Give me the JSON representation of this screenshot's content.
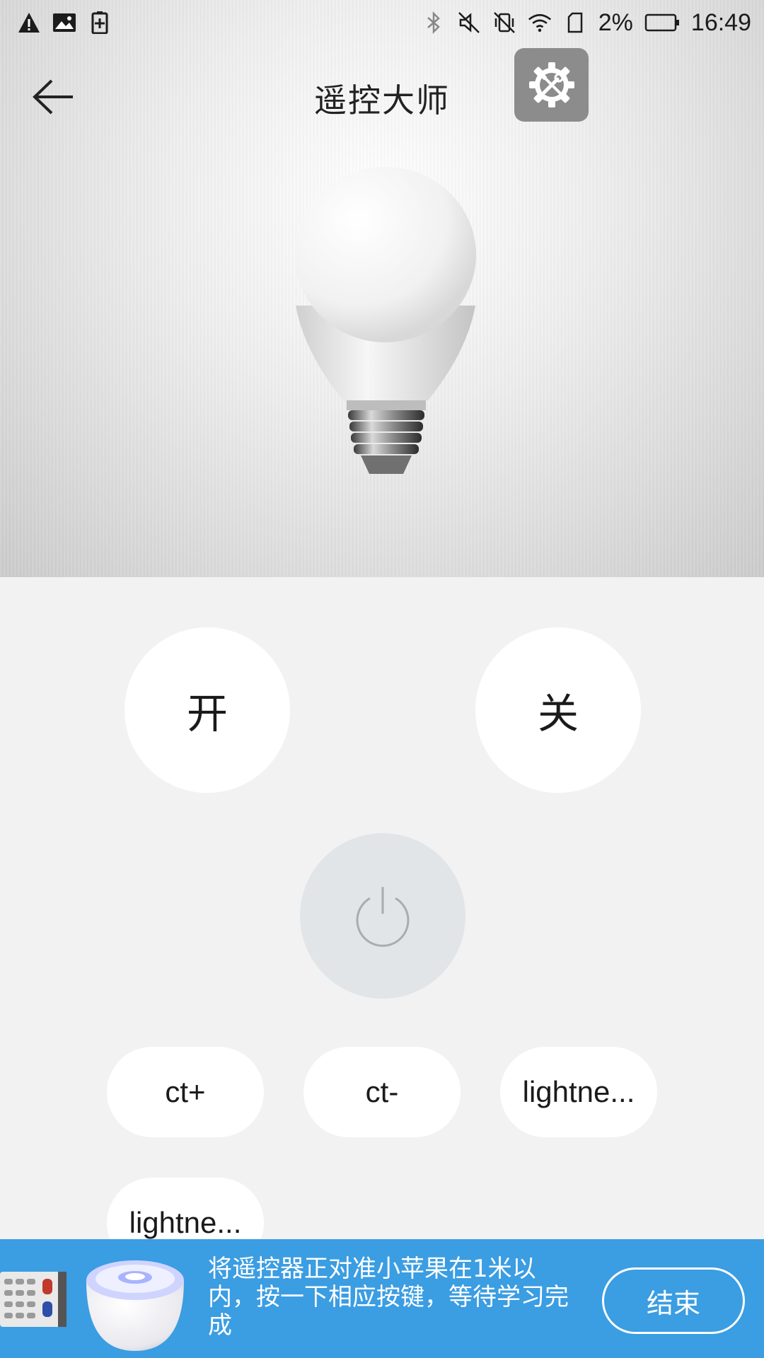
{
  "status_bar": {
    "battery_percent": "2%",
    "time": "16:49",
    "left_icons": [
      "warning-icon",
      "image-icon",
      "battery-plus-icon"
    ],
    "right_icons": [
      "bluetooth-icon",
      "mute-icon",
      "vibrate-off-icon",
      "wifi-icon",
      "sim-icon",
      "battery-icon"
    ]
  },
  "header": {
    "title": "遥控大师",
    "back_icon": "arrow-left-icon",
    "settings_icon": "gear-tools-icon"
  },
  "controls": {
    "on_label": "开",
    "off_label": "关",
    "power_icon": "power-icon",
    "pills": [
      {
        "label": "ct+"
      },
      {
        "label": "ct-"
      },
      {
        "label": "lightne..."
      },
      {
        "label": "lightne..."
      }
    ]
  },
  "banner": {
    "message": "将遥控器正对准小苹果在1米以内，按一下相应按键，等待学习完成",
    "end_label": "结束"
  }
}
